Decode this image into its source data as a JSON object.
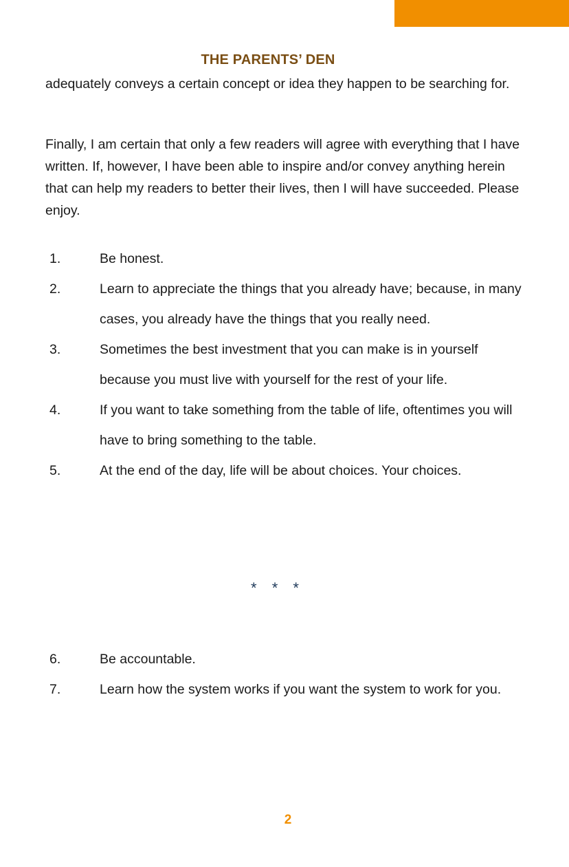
{
  "header": {
    "title": "THE PARENTS’ DEN"
  },
  "body": {
    "paragraph_continuation": "adequately conveys a certain concept or idea they happen to be searching for.",
    "paragraph_final": "Finally, I am certain that only a few readers will agree with everything that I have written. If, however, I have been able to inspire and/or convey anything herein that can help my readers to better their lives, then I will have succeeded. Please enjoy."
  },
  "list_a": [
    {
      "number": "1.",
      "text": "Be honest."
    },
    {
      "number": "2.",
      "text": "Learn to appreciate the things that you already have; because, in many cases, you already have the things that you really need."
    },
    {
      "number": "3.",
      "text": "Sometimes the best investment that you can make is in yourself because you must live with yourself for the rest of your life."
    },
    {
      "number": "4.",
      "text": "If you want to take something from the table of life, oftentimes you will have to bring something to the table."
    },
    {
      "number": "5.",
      "text": "At the end of the day, life will be about choices. Your choices."
    }
  ],
  "separator": "* * *",
  "list_b": [
    {
      "number": "6.",
      "text": "Be accountable."
    },
    {
      "number": "7.",
      "text": "Learn how the system works if you want the system to work for you."
    }
  ],
  "footer": {
    "page_number": "2"
  },
  "colors": {
    "accent": "#f18f00",
    "header_text": "#7a4e14",
    "separator": "#1f3a5a"
  }
}
